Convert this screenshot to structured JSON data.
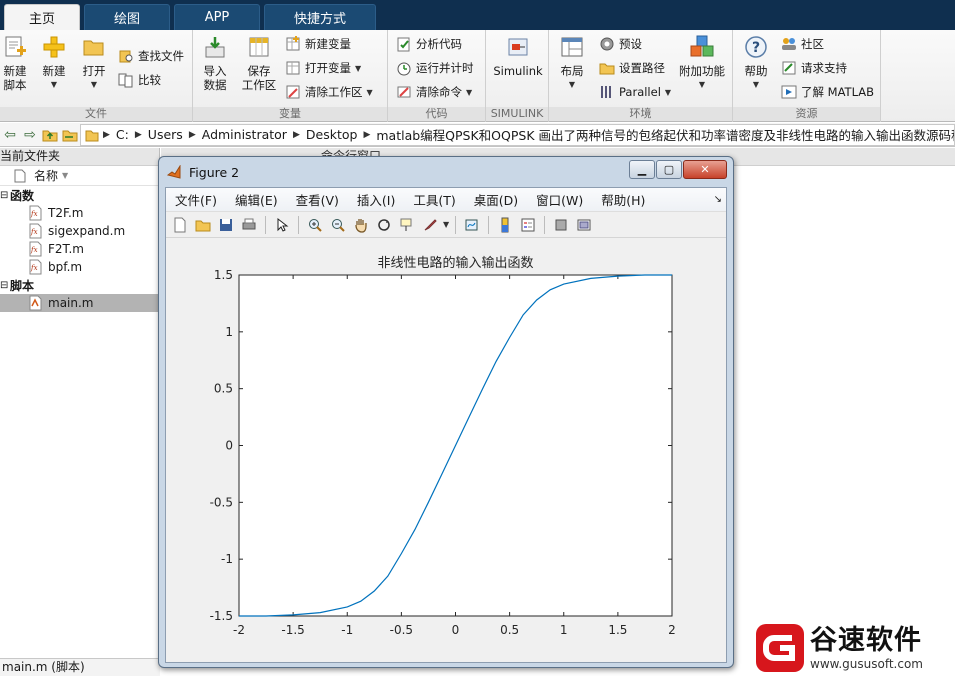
{
  "ribbon_tabs": [
    "主页",
    "绘图",
    "APP",
    "快捷方式"
  ],
  "ribbon": {
    "file": {
      "label": "文件",
      "new_script": "新建\n脚本",
      "new": "新建",
      "open": "打开",
      "find_files": "查找文件",
      "compare": "比较"
    },
    "variable": {
      "label": "变量",
      "import": "导入\n数据",
      "save_ws": "保存\n工作区",
      "new_var": "新建变量",
      "open_var": "打开变量",
      "clear_ws": "清除工作区"
    },
    "code": {
      "label": "代码",
      "analyze": "分析代码",
      "run_time": "运行并计时",
      "clear_cmd": "清除命令"
    },
    "simulink": {
      "label": "SIMULINK",
      "btn": "Simulink"
    },
    "env": {
      "label": "环境",
      "layout": "布局",
      "prefs": "预设",
      "set_path": "设置路径",
      "parallel": "Parallel",
      "addons": "附加功能"
    },
    "resources": {
      "label": "资源",
      "help": "帮助",
      "community": "社区",
      "support": "请求支持",
      "learn": "了解 MATLAB"
    }
  },
  "path": [
    "C:",
    "Users",
    "Administrator",
    "Desktop",
    "matlab编程QPSK和OQPSK 画出了两种信号的包络起伏和功率谱密度及非线性电路的输入输出函数源码程序"
  ],
  "file_panel": {
    "title": "当前文件夹",
    "column": "名称",
    "sections": [
      {
        "name": "函数",
        "files": [
          "T2F.m",
          "sigexpand.m",
          "F2T.m",
          "bpf.m"
        ]
      },
      {
        "name": "脚本",
        "files": [
          "main.m"
        ]
      }
    ],
    "status": "main.m  (脚本)"
  },
  "command_panel": {
    "title": "命令行窗口"
  },
  "figure": {
    "title": "Figure 2",
    "menus": [
      "文件(F)",
      "编辑(E)",
      "查看(V)",
      "插入(I)",
      "工具(T)",
      "桌面(D)",
      "窗口(W)",
      "帮助(H)"
    ]
  },
  "chart_data": {
    "type": "line",
    "title": "非线性电路的输入输出函数",
    "xlabel": "",
    "ylabel": "",
    "xlim": [
      -2,
      2
    ],
    "ylim": [
      -1.5,
      1.5
    ],
    "xticks": [
      -2,
      -1.5,
      -1,
      -0.5,
      0,
      0.5,
      1,
      1.5,
      2
    ],
    "yticks": [
      -1.5,
      -1,
      -0.5,
      0,
      0.5,
      1,
      1.5
    ],
    "grid": false,
    "color": "#0072bd",
    "series": [
      {
        "x": [
          -2,
          -1.75,
          -1.5,
          -1.25,
          -1.0,
          -0.875,
          -0.75,
          -0.625,
          -0.5,
          -0.375,
          -0.25,
          -0.125,
          0,
          0.125,
          0.25,
          0.375,
          0.5,
          0.625,
          0.75,
          0.875,
          1.0,
          1.25,
          1.5,
          1.75,
          2
        ],
        "y": [
          -1.5,
          -1.5,
          -1.49,
          -1.47,
          -1.42,
          -1.37,
          -1.28,
          -1.15,
          -0.95,
          -0.74,
          -0.5,
          -0.25,
          0,
          0.25,
          0.5,
          0.74,
          0.95,
          1.15,
          1.28,
          1.37,
          1.42,
          1.47,
          1.49,
          1.5,
          1.5
        ]
      }
    ]
  },
  "watermark": {
    "brand": "谷速软件",
    "url": "www.gususoft.com",
    "brand_color": "#d7161c"
  }
}
